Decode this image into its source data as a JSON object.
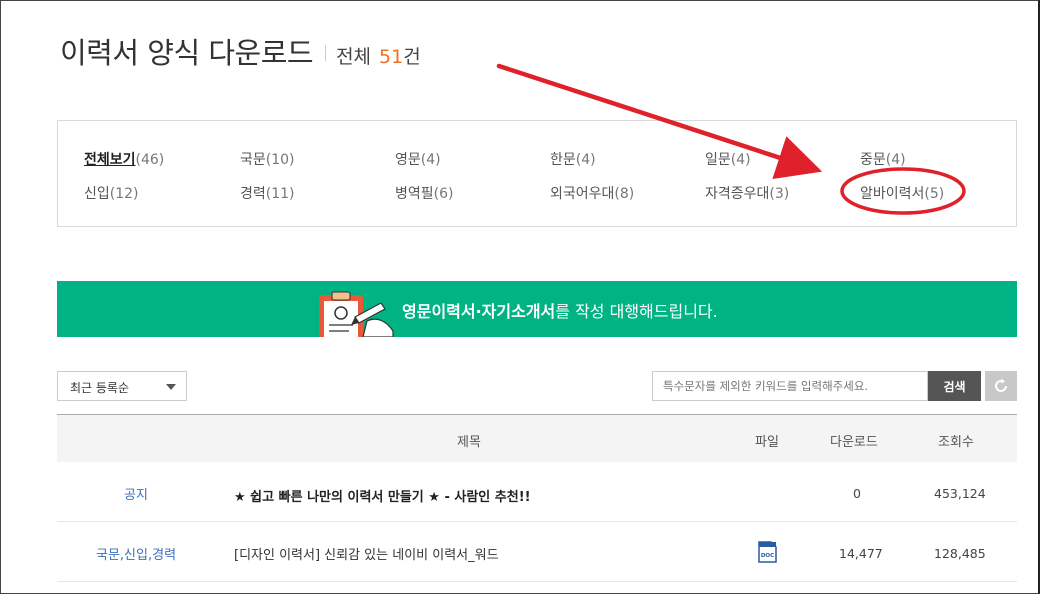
{
  "header": {
    "title": "이력서 양식 다운로드",
    "total_label": "전체",
    "total_count": "51",
    "total_unit": "건"
  },
  "categories": [
    {
      "name": "전체보기",
      "count": "(46)",
      "active": true
    },
    {
      "name": "국문",
      "count": "(10)"
    },
    {
      "name": "영문",
      "count": "(4)"
    },
    {
      "name": "한문",
      "count": "(4)"
    },
    {
      "name": "일문",
      "count": "(4)"
    },
    {
      "name": "중문",
      "count": "(4)"
    },
    {
      "name": "신입",
      "count": "(12)"
    },
    {
      "name": "경력",
      "count": "(11)"
    },
    {
      "name": "병역필",
      "count": "(6)"
    },
    {
      "name": "외국어우대",
      "count": "(8)"
    },
    {
      "name": "자격증우대",
      "count": "(3)"
    },
    {
      "name": "알바이력서",
      "count": "(5)"
    }
  ],
  "banner": {
    "highlight": "영문이력서·자기소개서",
    "text": "를 작성 대행해드립니다."
  },
  "toolbar": {
    "sort_label": "최근 등록순",
    "search_placeholder": "특수문자를 제외한 키워드를 입력해주세요.",
    "search_button": "검색"
  },
  "table": {
    "headers": {
      "title": "제목",
      "file": "파일",
      "downloads": "다운로드",
      "views": "조회수"
    },
    "rows": [
      {
        "category": "공지",
        "title": "★ 쉽고 빠른 나만의 이력서 만들기 ★ - 사람인 추천!!",
        "file": "",
        "downloads": "0",
        "views": "453,124"
      },
      {
        "category": "국문,신입,경력",
        "title": "[디자인 이력서] 신뢰감 있는 네이비 이력서_워드",
        "file": "doc-icon",
        "downloads": "14,477",
        "views": "128,485"
      }
    ]
  },
  "colors": {
    "accent_orange": "#f07020",
    "banner_green": "#00b383",
    "annotation_red": "#e0202a",
    "category_blue": "#3a6fc1"
  }
}
